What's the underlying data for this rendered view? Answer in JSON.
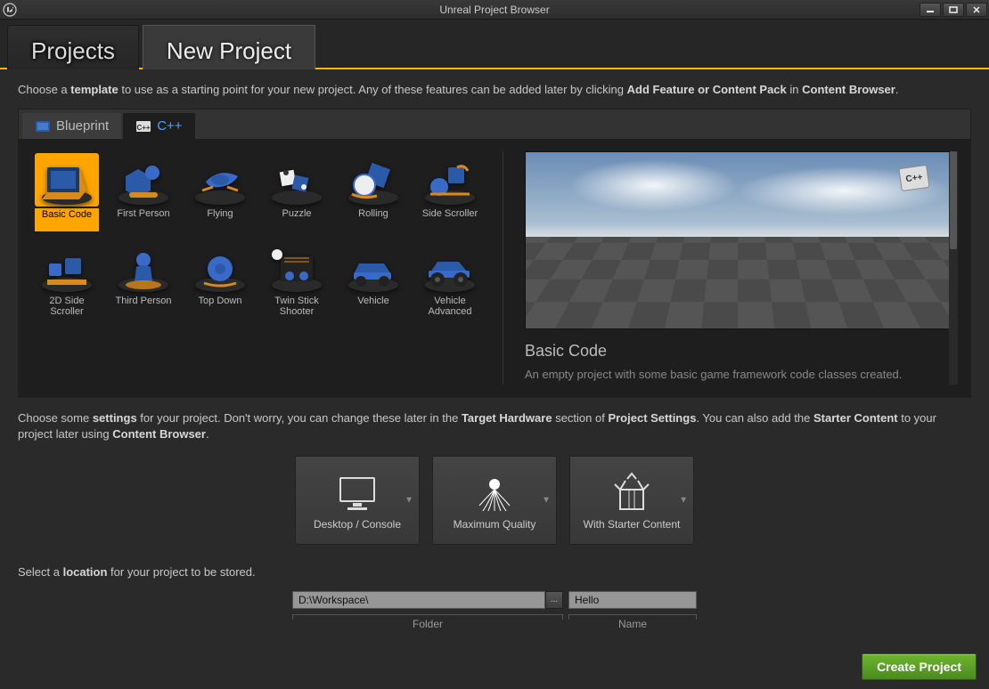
{
  "window": {
    "title": "Unreal Project Browser"
  },
  "tabs": {
    "projects": "Projects",
    "new_project": "New Project"
  },
  "intro": {
    "pre": "Choose a ",
    "b1": "template",
    "mid": " to use as a starting point for your new project.  Any of these features can be added later by clicking ",
    "b2": "Add Feature or Content Pack",
    "mid2": " in ",
    "b3": "Content Browser",
    "post": "."
  },
  "subtabs": {
    "blueprint": "Blueprint",
    "cpp": "C++"
  },
  "templates": [
    {
      "id": "basic-code",
      "label": "Basic Code",
      "selected": true
    },
    {
      "id": "first-person",
      "label": "First Person"
    },
    {
      "id": "flying",
      "label": "Flying"
    },
    {
      "id": "puzzle",
      "label": "Puzzle"
    },
    {
      "id": "rolling",
      "label": "Rolling"
    },
    {
      "id": "side-scroller",
      "label": "Side Scroller"
    },
    {
      "id": "2d-side-scroller",
      "label": "2D Side Scroller"
    },
    {
      "id": "third-person",
      "label": "Third Person"
    },
    {
      "id": "top-down",
      "label": "Top Down"
    },
    {
      "id": "twin-stick",
      "label": "Twin Stick Shooter"
    },
    {
      "id": "vehicle",
      "label": "Vehicle"
    },
    {
      "id": "vehicle-adv",
      "label": "Vehicle Advanced"
    }
  ],
  "preview": {
    "title": "Basic Code",
    "desc": "An empty project with some basic game framework code classes created.",
    "badge": "C++"
  },
  "settings_intro": {
    "pre": "Choose some ",
    "b1": "settings",
    "mid": " for your project.  Don't worry, you can change these later in the ",
    "b2": "Target Hardware",
    "mid2": " section of ",
    "b3": "Project Settings",
    "mid3": ".  You can also add the ",
    "b4": "Starter Content",
    "mid4": " to your project later using ",
    "b5": "Content Browser",
    "post": "."
  },
  "settings": {
    "hardware": "Desktop / Console",
    "quality": "Maximum Quality",
    "starter": "With Starter Content"
  },
  "location_help": {
    "pre": "Select a ",
    "b1": "location",
    "post": " for your project to be stored."
  },
  "location": {
    "folder_value": "D:\\Workspace\\",
    "folder_label": "Folder",
    "browse": "...",
    "name_value": "Hello",
    "name_label": "Name"
  },
  "footer": {
    "create": "Create Project"
  }
}
